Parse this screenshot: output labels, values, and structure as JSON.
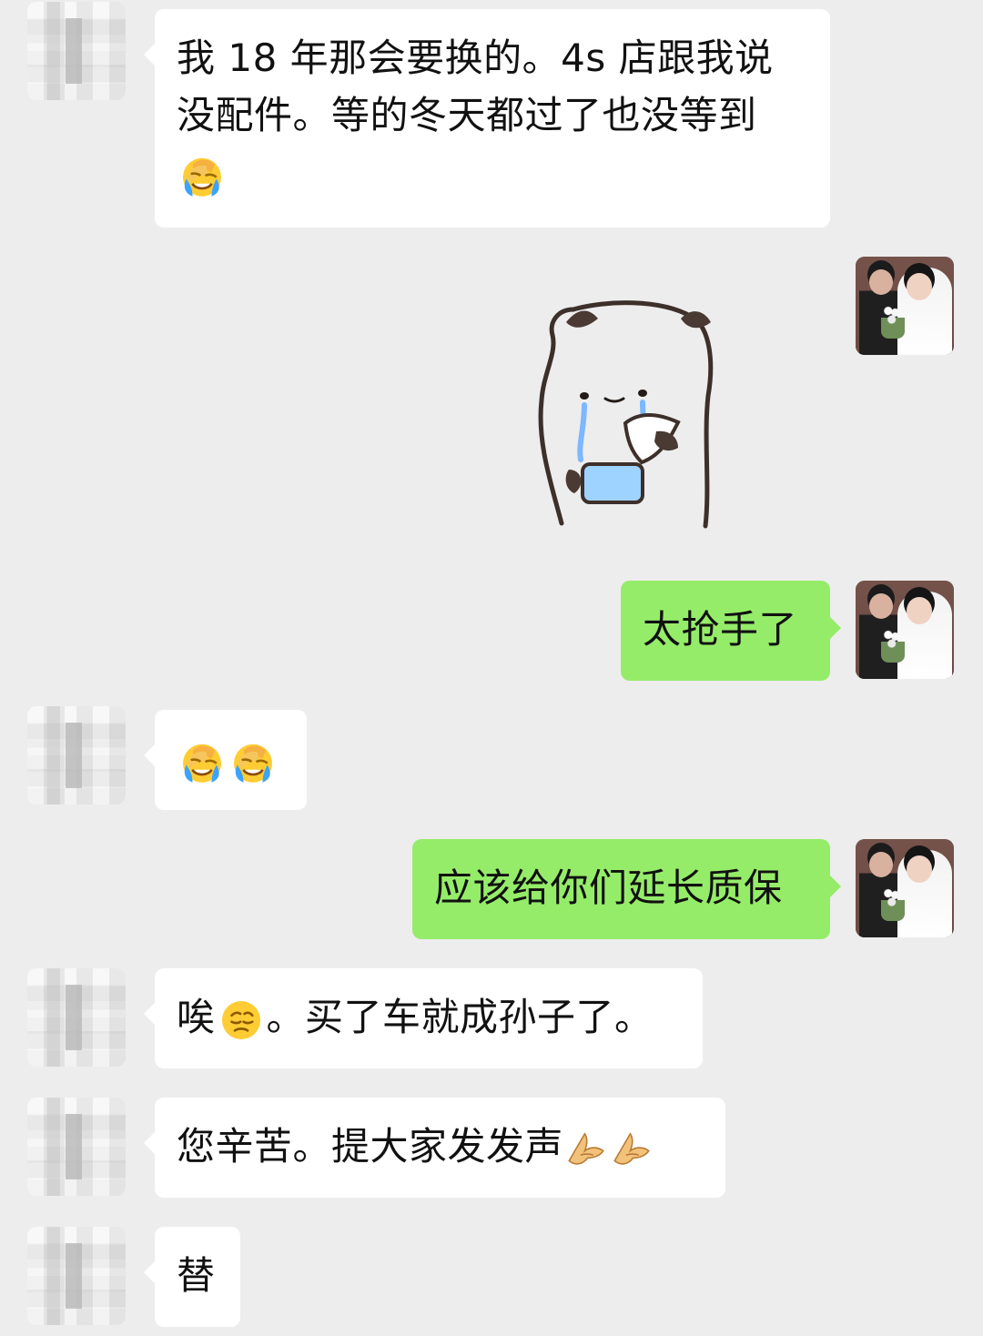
{
  "messages": [
    {
      "id": "m1",
      "direction": "incoming",
      "lines": [
        "我 18 年那会要换的。4s 店跟我说",
        "没配件。等的冬天都过了也没等到"
      ],
      "emoji": "face-palm-crying-emoji"
    },
    {
      "id": "m2",
      "direction": "outgoing",
      "sticker": "panda-crying-sticker"
    },
    {
      "id": "m3",
      "direction": "outgoing",
      "text": "太抢手了"
    },
    {
      "id": "m4",
      "direction": "incoming",
      "emoji_sequence": [
        "face-palm-crying-emoji",
        "face-palm-crying-emoji"
      ]
    },
    {
      "id": "m5",
      "direction": "outgoing",
      "text": "应该给你们延长质保"
    },
    {
      "id": "m6",
      "direction": "incoming",
      "prefix": "唉",
      "emoji": "pensive-face-emoji",
      "suffix": "。买了车就成孙子了。"
    },
    {
      "id": "m7",
      "direction": "incoming",
      "prefix": "您辛苦。提大家发发声",
      "emoji_sequence": [
        "pinched-fingers-emoji",
        "pinched-fingers-emoji"
      ]
    },
    {
      "id": "m8",
      "direction": "incoming",
      "text": "替"
    }
  ]
}
